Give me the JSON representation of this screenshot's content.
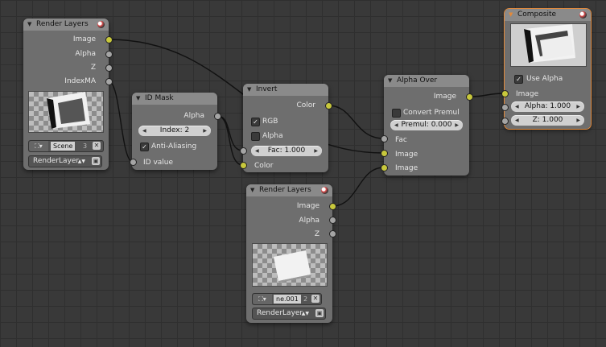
{
  "nodes": {
    "render_layers_1": {
      "title": "Render Layers",
      "outputs": [
        "Image",
        "Alpha",
        "Z",
        "IndexMA"
      ],
      "scene": {
        "name": "Scene",
        "users": "3"
      },
      "layer": "RenderLayer"
    },
    "id_mask": {
      "title": "ID Mask",
      "output": "Alpha",
      "index_field": "Index: 2",
      "anti_aliasing": "Anti-Aliasing",
      "anti_aliasing_checked": true,
      "input": "ID value"
    },
    "invert": {
      "title": "Invert",
      "output": "Color",
      "rgb": "RGB",
      "rgb_checked": true,
      "alpha": "Alpha",
      "alpha_checked": false,
      "fac_field": "Fac: 1.000",
      "input": "Color"
    },
    "alpha_over": {
      "title": "Alpha Over",
      "output": "Image",
      "convert_premul": "Convert Premul",
      "convert_premul_checked": false,
      "premul_field": "Premul: 0.000",
      "inputs": [
        "Fac",
        "Image",
        "Image"
      ]
    },
    "render_layers_2": {
      "title": "Render Layers",
      "outputs": [
        "Image",
        "Alpha",
        "Z"
      ],
      "scene": {
        "name": "ne.001",
        "users": "2"
      },
      "layer": "RenderLayer"
    },
    "composite": {
      "title": "Composite",
      "use_alpha": "Use Alpha",
      "use_alpha_checked": true,
      "input_image": "Image",
      "alpha_field": "Alpha: 1.000",
      "z_field": "Z: 1.000"
    }
  },
  "colors": {
    "background": "#393939",
    "grid": "#2f2f2f",
    "node_body": "#6e6e6e",
    "node_header": "#8a8a8a",
    "socket_color": "#c8c83c",
    "socket_value": "#a5a5a5",
    "selected_outline": "#e2893a"
  },
  "icons": {
    "collapse": "triangle-down-icon",
    "preview": "sphere-preview-icon",
    "scene": "scene-icon",
    "unlink": "x-icon",
    "render": "render-icon"
  }
}
